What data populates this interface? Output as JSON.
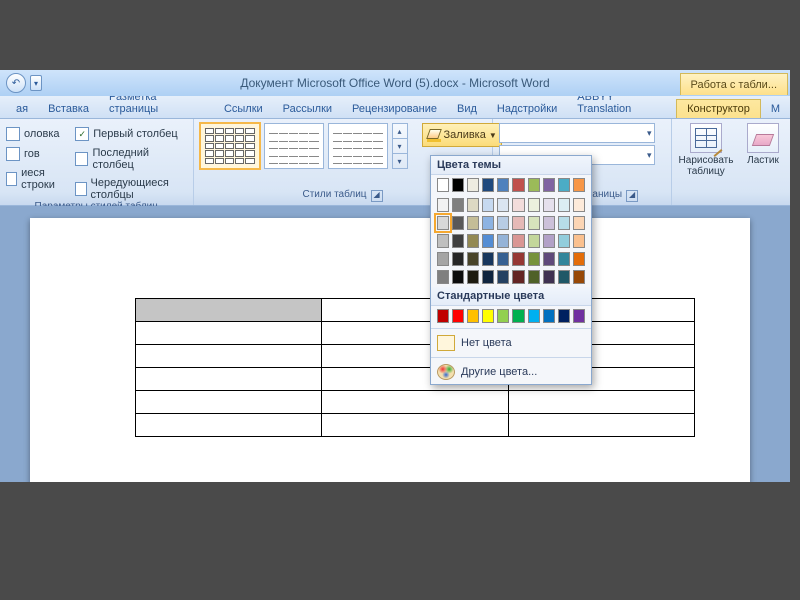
{
  "title": "Документ Microsoft Office Word (5).docx - Microsoft Word",
  "context_tab": "Работа с табли...",
  "tabs": {
    "t0": "ая",
    "t1": "Вставка",
    "t2": "Разметка страницы",
    "t3": "Ссылки",
    "t4": "Рассылки",
    "t5": "Рецензирование",
    "t6": "Вид",
    "t7": "Надстройки",
    "t8": "ABBYY Translation",
    "t9": "Конструктор",
    "t10": "М"
  },
  "opts": {
    "c1": "оловка",
    "c2": "гов",
    "c3": "иеся строки",
    "c4": "Первый столбец",
    "c5": "Последний столбец",
    "c6": "Чередующиеся столбцы"
  },
  "groups": {
    "g1": "Параметры стилей таблиц",
    "g2": "Стили таблиц",
    "g3": "Нарисовать границы"
  },
  "shading_btn": "Заливка",
  "draw_table": "Нарисовать таблицу",
  "eraser": "Ластик",
  "dd": {
    "theme": "Цвета темы",
    "standard": "Стандартные цвета",
    "nocolor": "Нет цвета",
    "more": "Другие цвета..."
  },
  "theme_row1": [
    "#ffffff",
    "#000000",
    "#eeece1",
    "#1f497d",
    "#4f81bd",
    "#c0504d",
    "#9bbb59",
    "#8064a2",
    "#4bacc6",
    "#f79646"
  ],
  "theme_shades": [
    [
      "#f2f2f2",
      "#7f7f7f",
      "#ddd9c3",
      "#c6d9f0",
      "#dbe5f1",
      "#f2dcdb",
      "#ebf1dd",
      "#e5e0ec",
      "#dbeef3",
      "#fdeada"
    ],
    [
      "#d8d8d8",
      "#595959",
      "#c4bd97",
      "#8db3e2",
      "#b8cce4",
      "#e5b9b7",
      "#d7e3bc",
      "#ccc1d9",
      "#b7dde8",
      "#fbd5b5"
    ],
    [
      "#bfbfbf",
      "#3f3f3f",
      "#938953",
      "#548dd4",
      "#95b3d7",
      "#d99694",
      "#c3d69b",
      "#b2a1c7",
      "#92cddc",
      "#fac08f"
    ],
    [
      "#a5a5a5",
      "#262626",
      "#494429",
      "#17365d",
      "#366092",
      "#953734",
      "#76923c",
      "#5f497a",
      "#31859b",
      "#e36c09"
    ],
    [
      "#7f7f7f",
      "#0c0c0c",
      "#1d1b10",
      "#0f243e",
      "#244061",
      "#632423",
      "#4f6128",
      "#3f3151",
      "#205867",
      "#974806"
    ]
  ],
  "standard_colors": [
    "#c00000",
    "#ff0000",
    "#ffc000",
    "#ffff00",
    "#92d050",
    "#00b050",
    "#00b0f0",
    "#0070c0",
    "#002060",
    "#7030a0"
  ]
}
